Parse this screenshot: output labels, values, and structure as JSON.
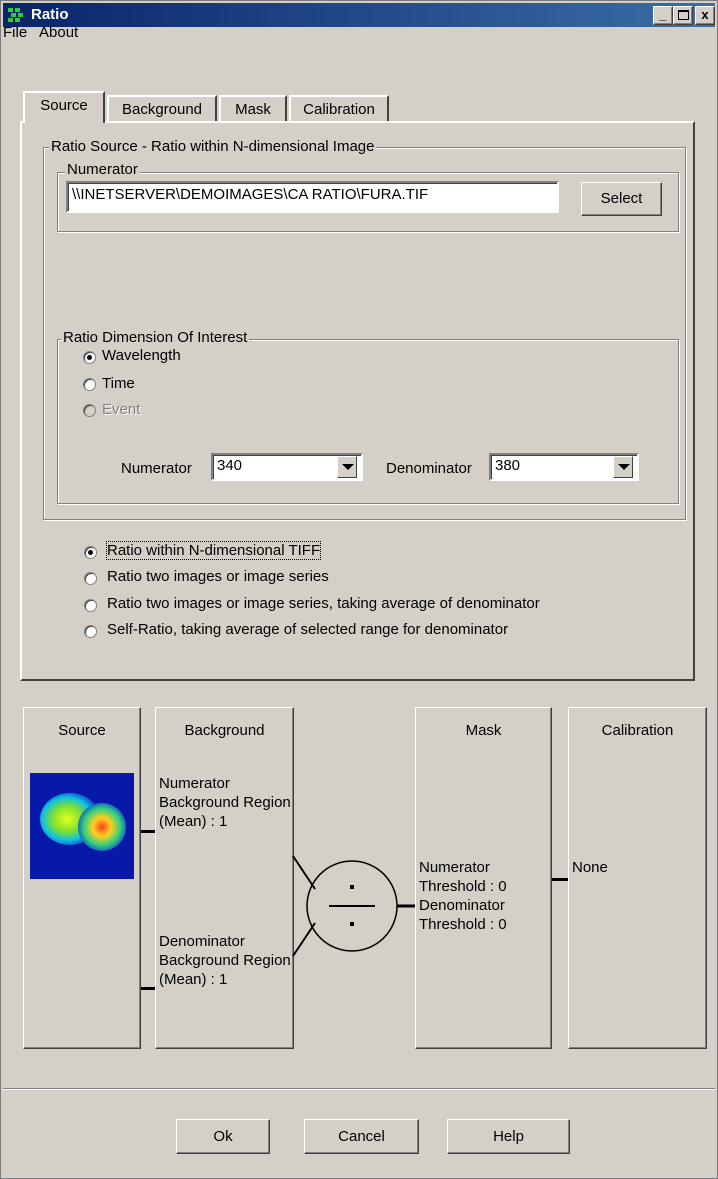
{
  "window": {
    "title": "Ratio"
  },
  "menu": {
    "file": "File",
    "about": "About"
  },
  "tabs": [
    "Source",
    "Background",
    "Mask",
    "Calibration"
  ],
  "source_group": {
    "label": "Ratio Source - Ratio within N-dimensional Image",
    "numerator_label": "Numerator",
    "numerator_path": "\\\\INETSERVER\\DEMOIMAGES\\CA RATIO\\FURA.TIF",
    "select_button": "Select"
  },
  "dimension_group": {
    "label": "Ratio Dimension Of Interest",
    "options": [
      "Wavelength",
      "Time",
      "Event"
    ],
    "selected": "Wavelength",
    "numerator_label": "Numerator",
    "numerator_value": "340",
    "denominator_label": "Denominator",
    "denominator_value": "380"
  },
  "ratio_modes": {
    "options": [
      "Ratio within N-dimensional TIFF",
      "Ratio two images or image series",
      "Ratio two images or image series, taking average of denominator",
      "Self-Ratio, taking average of selected range for denominator"
    ],
    "selected": 0
  },
  "pipeline": {
    "source_title": "Source",
    "background_title": "Background",
    "numerator_background": "Numerator Background Region (Mean) : 1",
    "denominator_background": "Denominator Background Region (Mean) : 1",
    "mask_title": "Mask",
    "mask_text": "Numerator Threshold : 0 Denominator Threshold : 0",
    "calibration_title": "Calibration",
    "calibration_text": "None"
  },
  "buttons": {
    "ok": "Ok",
    "cancel": "Cancel",
    "help": "Help"
  },
  "icons": {
    "app": "ratio-app-icon",
    "minimize": "minimize-icon",
    "maximize": "maximize-icon",
    "close": "close-icon",
    "divide": "divide-icon"
  }
}
